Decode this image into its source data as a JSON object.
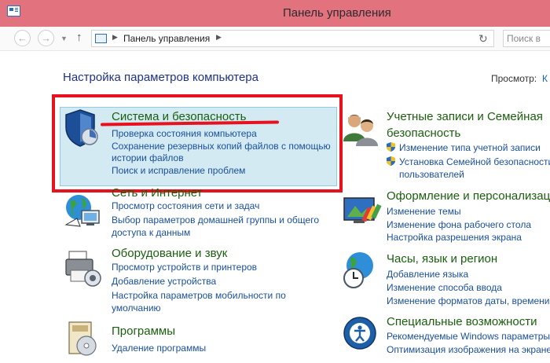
{
  "window": {
    "title": "Панель управления"
  },
  "address": {
    "crumb": "Панель управления",
    "search_placeholder": "Поиск в"
  },
  "page": {
    "heading": "Настройка параметров компьютера",
    "view_label": "Просмотр:",
    "view_value": "К"
  },
  "categories": [
    {
      "title": "Система и безопасность",
      "links": [
        "Проверка состояния компьютера",
        "Сохранение резервных копий файлов с помощью",
        "истории файлов",
        "Поиск и исправление проблем"
      ]
    },
    {
      "title": "Сеть и Интернет",
      "links": [
        "Просмотр состояния сети и задач",
        "Выбор параметров домашней группы и общего",
        "доступа к данным"
      ]
    },
    {
      "title": "Оборудование и звук",
      "links": [
        "Просмотр устройств и принтеров",
        "Добавление устройства",
        "Настройка параметров мобильности по",
        "умолчанию"
      ]
    },
    {
      "title": "Программы",
      "links": [
        "Удаление программы"
      ]
    },
    {
      "title": "Учетные записи и Семейная",
      "title2": "безопасность",
      "links": [
        "Изменение типа учетной записи",
        "Установка Семейной безопасности",
        "пользователей"
      ]
    },
    {
      "title": "Оформление и персонализация",
      "links": [
        "Изменение темы",
        "Изменение фона рабочего стола",
        "Настройка разрешения экрана"
      ]
    },
    {
      "title": "Часы, язык и регион",
      "links": [
        "Добавление языка",
        "Изменение способа ввода",
        "Изменение форматов даты, времени"
      ]
    },
    {
      "title": "Специальные возможности",
      "links": [
        "Рекомендуемые Windows параметры",
        "Оптимизация изображения на экране"
      ]
    }
  ],
  "colors": {
    "titlebar": "#e3727f",
    "category_title": "#1a5e0e",
    "link": "#1a4f9c",
    "highlight": "#d3eaf3",
    "annotation": "#e8121e"
  }
}
